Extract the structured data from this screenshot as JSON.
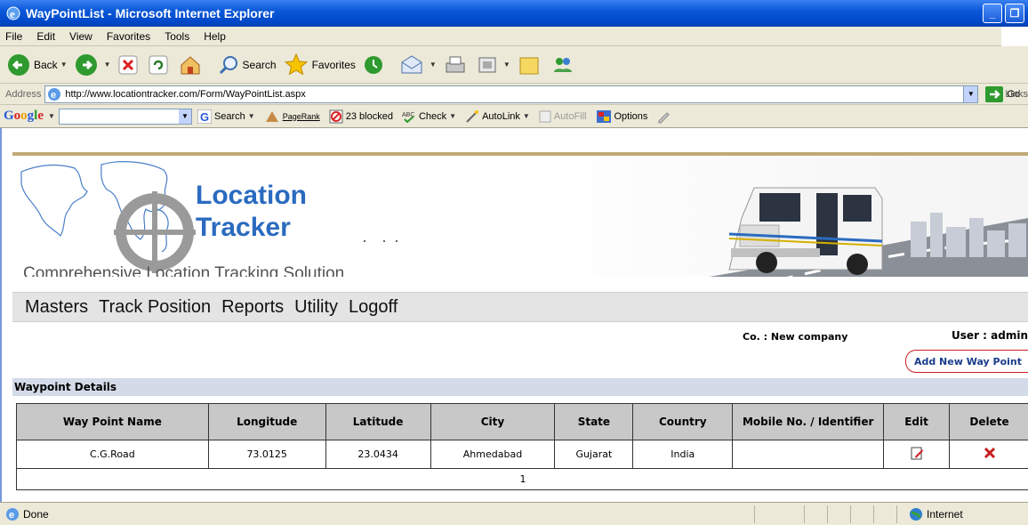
{
  "window": {
    "title": "WayPointList - Microsoft Internet Explorer"
  },
  "menu": [
    "File",
    "Edit",
    "View",
    "Favorites",
    "Tools",
    "Help"
  ],
  "toolbar": {
    "back": "Back",
    "search": "Search",
    "favorites": "Favorites"
  },
  "address": {
    "label": "Address",
    "url": "http://www.locationtracker.com/Form/WayPointList.aspx",
    "go": "Go",
    "links": "Links"
  },
  "googlebar": {
    "logo": "Google",
    "search": "Search",
    "pagerank": "PageRank",
    "blocked": "23 blocked",
    "check": "Check",
    "autolink": "AutoLink",
    "autofill": "AutoFill",
    "options": "Options"
  },
  "brand": {
    "line1": "Location",
    "line2": "Tracker",
    "tagline": "Comprehensive Location Tracking Solution"
  },
  "nav": [
    "Masters",
    "Track Position",
    "Reports",
    "Utility",
    "Logoff"
  ],
  "info": {
    "company": "Co. : New company",
    "user": "User : admin"
  },
  "add_button": "Add New Way Point",
  "section_title": "Waypoint Details",
  "table": {
    "headers": [
      "Way Point Name",
      "Longitude",
      "Latitude",
      "City",
      "State",
      "Country",
      "Mobile No. / Identifier",
      "Edit",
      "Delete"
    ],
    "rows": [
      [
        "C.G.Road",
        "73.0125",
        "23.0434",
        "Ahmedabad",
        "Gujarat",
        "India",
        ""
      ]
    ],
    "page": "1"
  },
  "status": {
    "text": "Done",
    "zone": "Internet"
  },
  "colors": {
    "brand_blue": "#2a6bbf",
    "titlebar": "#0a58d8",
    "header_gray": "#c8c8c8",
    "delete_red": "#c81e1e"
  }
}
